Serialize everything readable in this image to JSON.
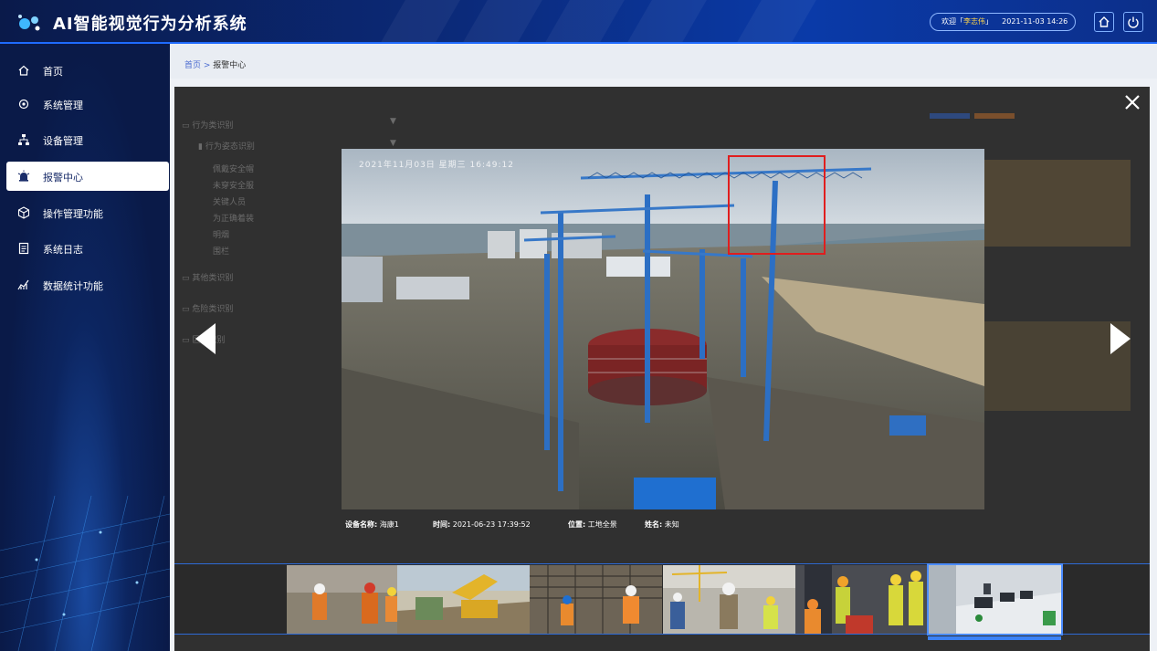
{
  "app": {
    "title": "AI智能视觉行为分析系统"
  },
  "header": {
    "welcome_prefix": "欢迎「",
    "username": "李志伟",
    "welcome_suffix": "」",
    "datetime": "2021-11-03 14:26",
    "home_icon": "home-icon",
    "power_icon": "power-icon"
  },
  "sidebar": {
    "items": [
      {
        "label": "首页",
        "icon": "home-icon",
        "active": false
      },
      {
        "label": "系统管理",
        "icon": "gear-icon",
        "active": false
      },
      {
        "label": "设备管理",
        "icon": "network-icon",
        "active": false
      },
      {
        "label": "报警中心",
        "icon": "alarm-icon",
        "active": true
      },
      {
        "label": "操作管理功能",
        "icon": "cube-icon",
        "active": false
      },
      {
        "label": "系统日志",
        "icon": "log-icon",
        "active": false
      },
      {
        "label": "数据统计功能",
        "icon": "chart-icon",
        "active": false
      }
    ]
  },
  "breadcrumb": {
    "home": "首页",
    "sep": " > ",
    "current": "报警中心"
  },
  "tree": {
    "items": [
      {
        "label": "行为类识别"
      },
      {
        "label": "行为姿态识别"
      },
      {
        "label": "佩戴安全帽"
      },
      {
        "label": "未穿安全服"
      },
      {
        "label": "关键人员"
      },
      {
        "label": "为正确着装"
      },
      {
        "label": "明烟"
      },
      {
        "label": "围栏"
      },
      {
        "label": "其他类识别"
      },
      {
        "label": "危险类识别"
      },
      {
        "label": "区类识别"
      }
    ]
  },
  "viewer": {
    "photo_stamp": "2021年11月03日  星期三  16:49:12",
    "device_label": "设备名称:",
    "device_value": "海康1",
    "time_label": "时间:",
    "time_value": "2021-06-23  17:39:52",
    "location_label": "位置:",
    "location_value": "工地全景",
    "name_label": "姓名:",
    "name_value": "未知",
    "thumbnails": [
      {
        "scene": "workers-helmets",
        "selected": false
      },
      {
        "scene": "excavator",
        "selected": false
      },
      {
        "scene": "rebar-site",
        "selected": false
      },
      {
        "scene": "crane-workers",
        "selected": false
      },
      {
        "scene": "workers-vests",
        "selected": false
      },
      {
        "scene": "office-room",
        "selected": true
      }
    ]
  },
  "colors": {
    "accent": "#1f6bff",
    "alert": "#e01e1e",
    "brand_dark": "#0a1a48"
  }
}
